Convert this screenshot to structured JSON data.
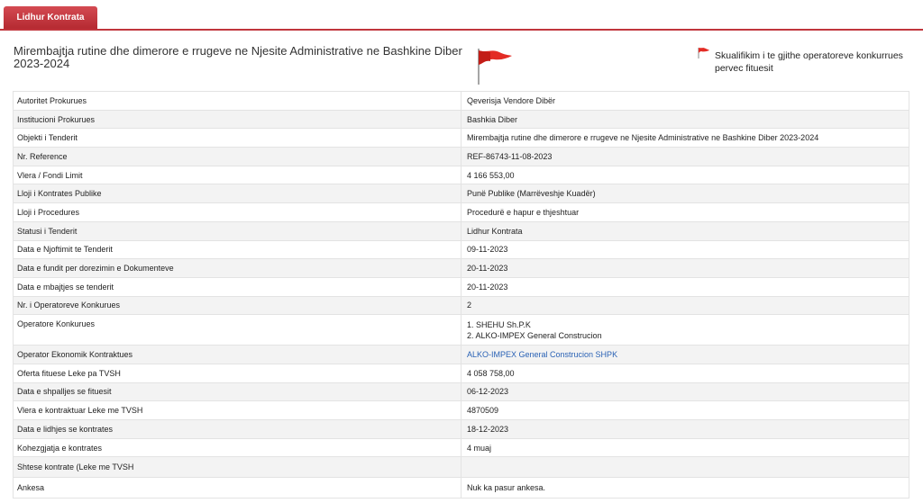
{
  "tab": {
    "label": "Lidhur Kontrata"
  },
  "title": "Mirembajtja rutine dhe dimerore e rrugeve ne Njesite Administrative ne Bashkine Diber 2023-2024",
  "disqualification": "Skualifikim i te gjithe operatoreve konkurrues pervec fituesit",
  "colors": {
    "accent": "#c0353c",
    "flag": "#e32c25",
    "link": "#2a62b5"
  },
  "rows": [
    {
      "label": "Autoritet Prokurues",
      "value": "Qeverisja Vendore Dibër"
    },
    {
      "label": "Institucioni Prokurues",
      "value": "Bashkia Diber"
    },
    {
      "label": "Objekti i Tenderit",
      "value": "Mirembajtja rutine dhe dimerore e rrugeve ne Njesite Administrative ne Bashkine Diber 2023-2024"
    },
    {
      "label": "Nr. Reference",
      "value": "REF-86743-11-08-2023"
    },
    {
      "label": "Vlera / Fondi Limit",
      "value": "4 166 553,00"
    },
    {
      "label": "Lloji i Kontrates Publike",
      "value": "Punë Publike (Marrëveshje Kuadër)"
    },
    {
      "label": "Lloji i Procedures",
      "value": "Procedurë e hapur e thjeshtuar"
    },
    {
      "label": "Statusi i Tenderit",
      "value": "Lidhur Kontrata"
    },
    {
      "label": "Data e Njoftimit te Tenderit",
      "value": "09-11-2023"
    },
    {
      "label": "Data e fundit per dorezimin e Dokumenteve",
      "value": "20-11-2023"
    },
    {
      "label": "Data e mbajtjes se tenderit",
      "value": "20-11-2023"
    },
    {
      "label": "Nr. i Operatoreve Konkurues",
      "value": "2"
    }
  ],
  "operators": {
    "label": "Operatore Konkurues",
    "items": [
      "1. SHEHU Sh.P.K",
      "2. ALKO-IMPEX General Construcion"
    ]
  },
  "contractor": {
    "label": "Operator Ekonomik Kontraktues",
    "value": "ALKO-IMPEX General Construcion SHPK"
  },
  "rows2": [
    {
      "label": "Oferta fituese Leke pa TVSH",
      "value": "4 058 758,00"
    },
    {
      "label": "Data e shpalljes se fituesit",
      "value": "06-12-2023"
    },
    {
      "label": "Vlera e kontraktuar Leke me TVSH",
      "value": "4870509"
    },
    {
      "label": "Data e lidhjes se kontrates",
      "value": "18-12-2023"
    },
    {
      "label": "Kohezgjatja e kontrates",
      "value": "4 muaj"
    },
    {
      "label": "Shtese kontrate (Leke me TVSH",
      "value": ""
    },
    {
      "label": "Ankesa",
      "value": "Nuk ka pasur ankesa."
    }
  ]
}
